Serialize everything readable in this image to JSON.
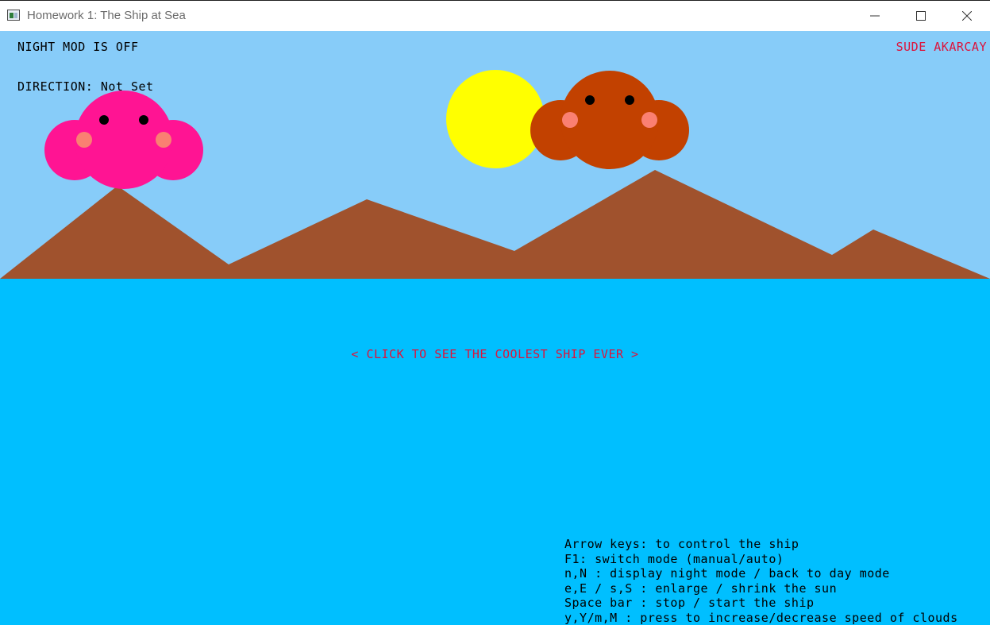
{
  "window": {
    "title": "Homework 1: The Ship at Sea"
  },
  "hud": {
    "night_mode": "NIGHT MOD IS OFF",
    "direction_label": "DIRECTION:",
    "direction_value": "Not Set",
    "author": "SUDE AKARCAY",
    "prompt": "< CLICK TO SEE THE COOLEST SHIP EVER >"
  },
  "help": [
    "Arrow keys: to control the ship",
    "F1: switch mode (manual/auto)",
    "n,N : display night mode / back to day mode",
    "e,E / s,S : enlarge / shrink the sun",
    "Space bar : stop / start the ship",
    "y,Y/m,M : press to increase/decrease speed of clouds"
  ],
  "colors": {
    "sky": "#87ccf9",
    "sea": "#00bfff",
    "mountain": "#a0522d",
    "sun": "#ffff00",
    "cloud_left": "#ff1493",
    "cloud_right": "#c24100",
    "cheek": "#fa8072",
    "eye": "#000000",
    "accent_text": "#dc143c"
  },
  "icons": {
    "app": "app-window-icon",
    "minimize": "minimize-icon",
    "maximize": "maximize-icon",
    "close": "close-icon"
  }
}
